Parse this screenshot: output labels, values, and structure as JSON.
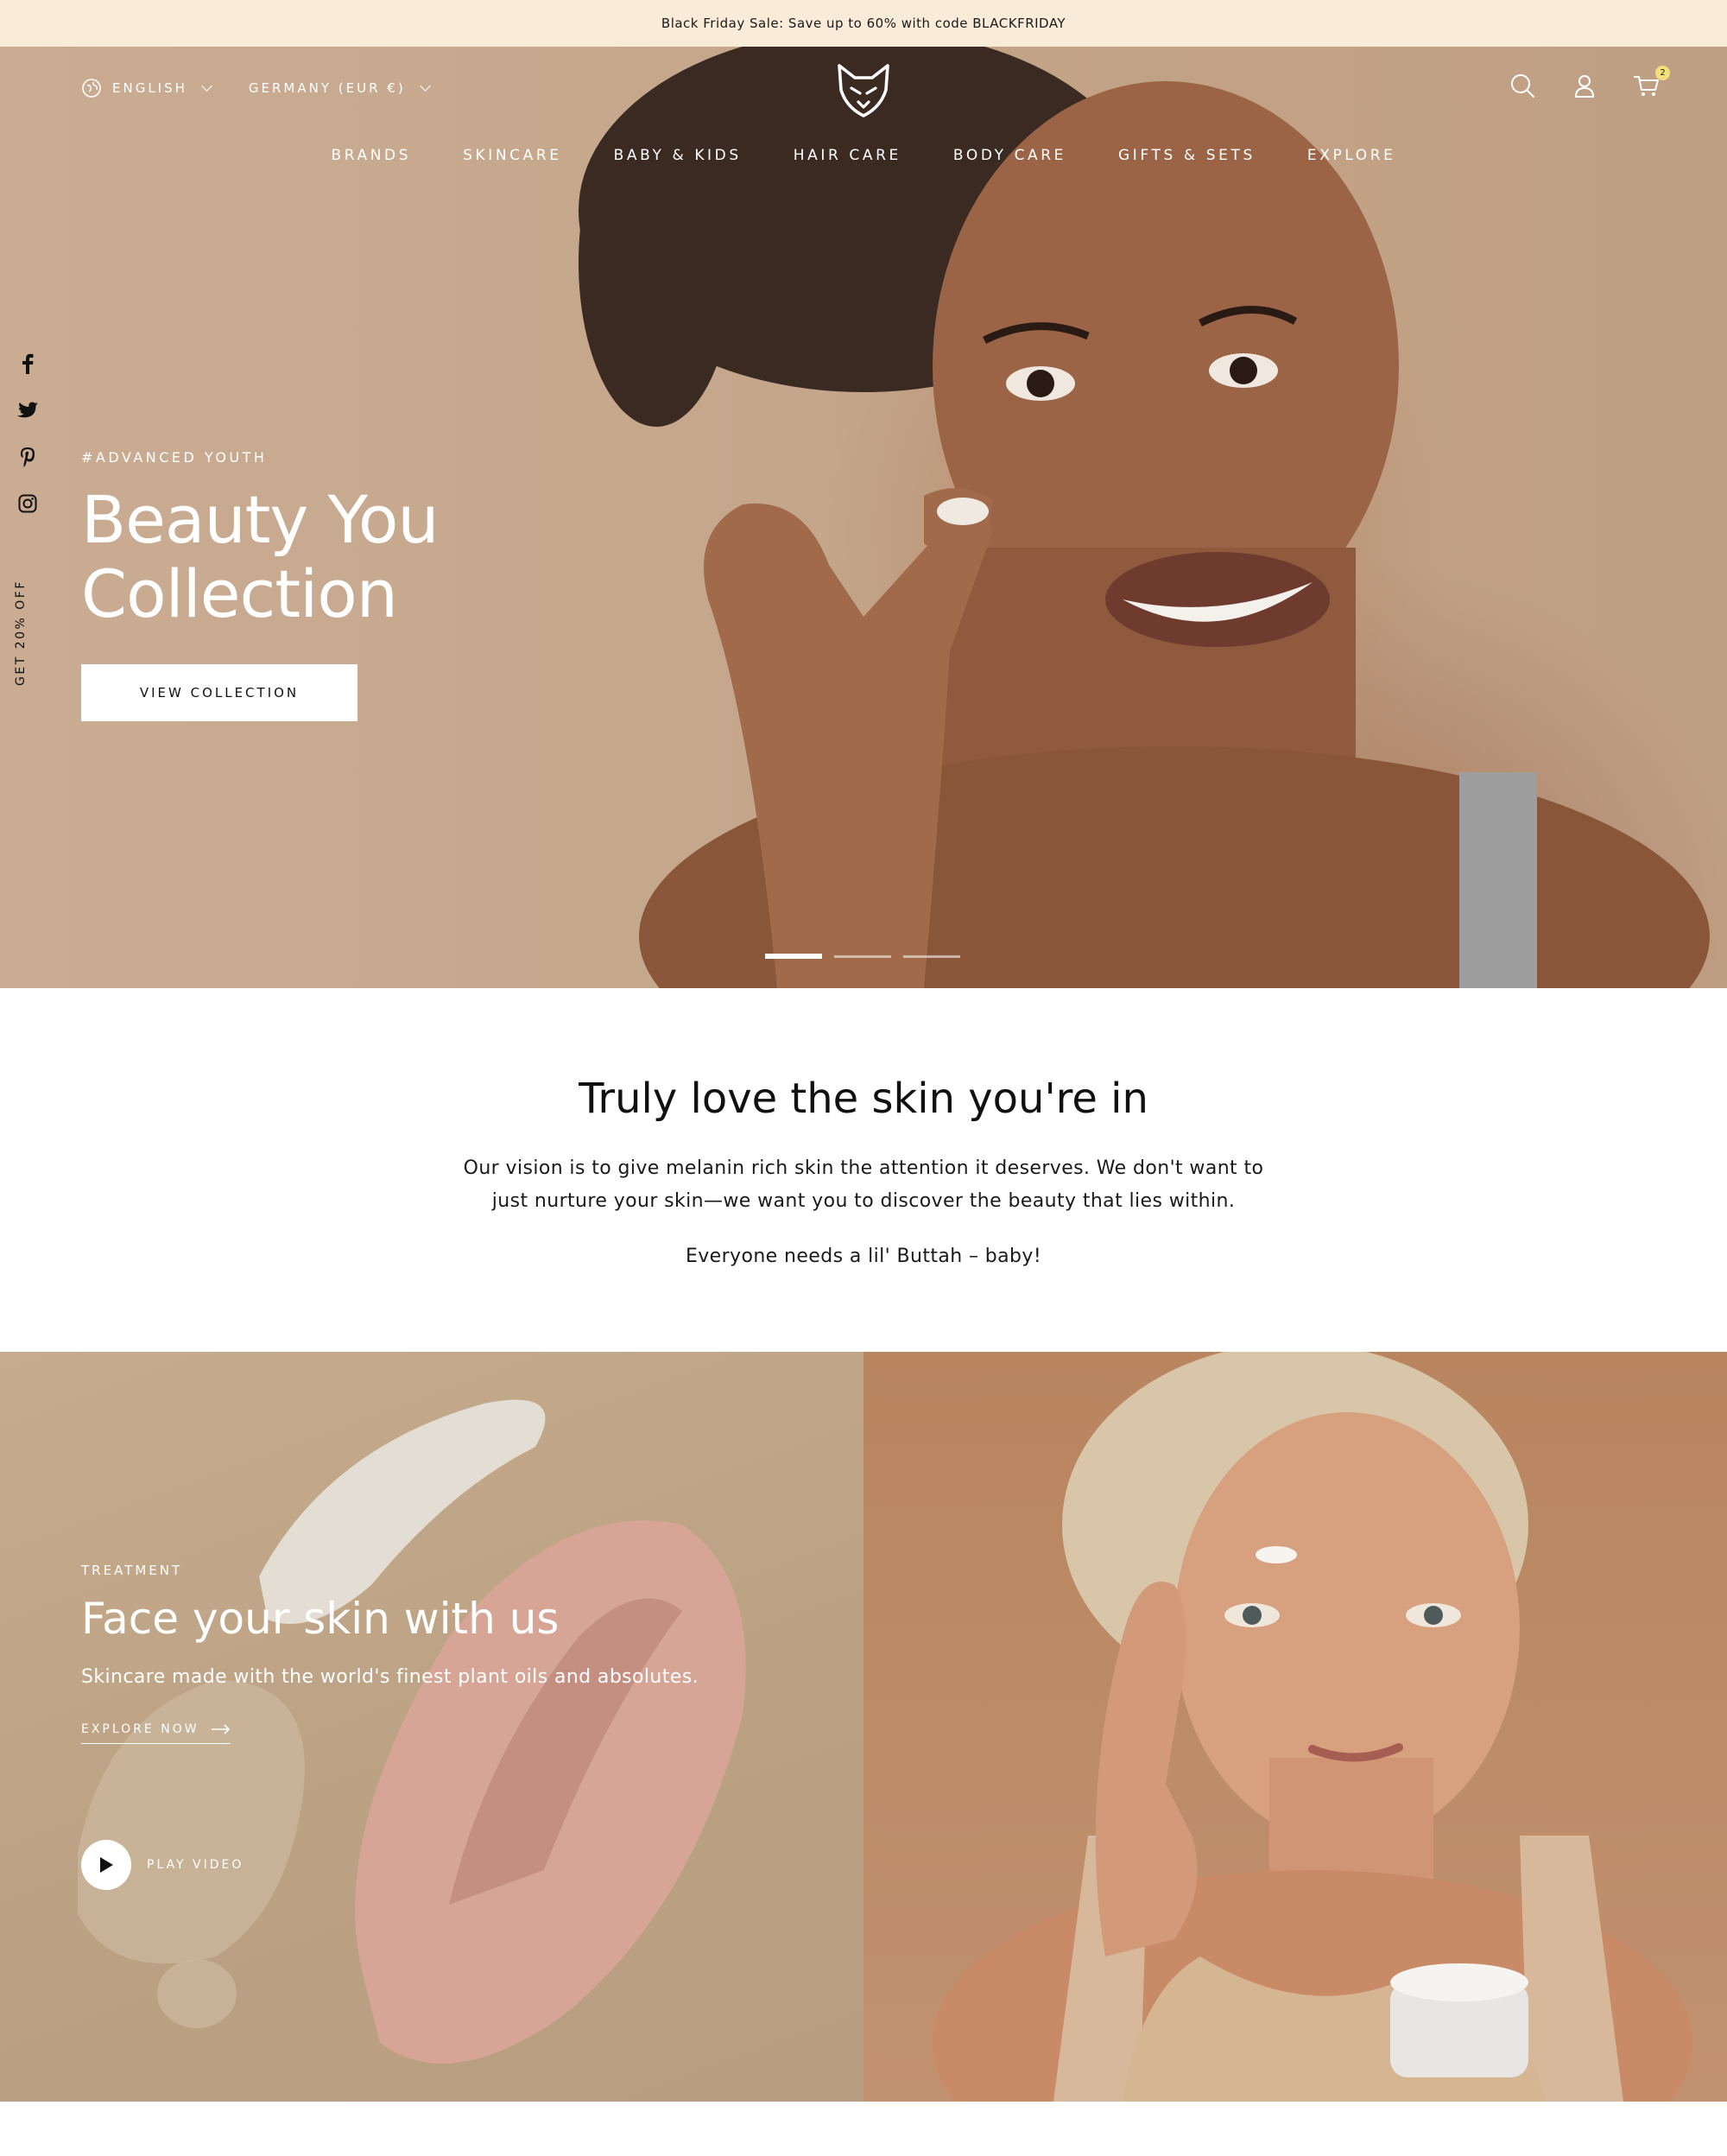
{
  "announcement": "Black Friday Sale: Save up to 60% with code BLACKFRIDAY",
  "header": {
    "language": "ENGLISH",
    "region": "GERMANY (EUR €)",
    "cart_count": "2"
  },
  "nav": [
    "BRANDS",
    "SKINCARE",
    "BABY & KIDS",
    "HAIR CARE",
    "BODY CARE",
    "GIFTS & SETS",
    "EXPLORE"
  ],
  "side_promo": "GET 20% OFF",
  "hero": {
    "tag": "#ADVANCED YOUTH",
    "title": "Beauty You Collection",
    "button": "VIEW COLLECTION",
    "slides_total": 3,
    "active_slide": 1
  },
  "intro": {
    "heading": "Truly love the skin you're in",
    "paragraph": "Our vision is to give melanin rich skin the attention it deserves. We don't want to just nurture your skin—we want you to discover the beauty that lies within.",
    "tagline": "Everyone needs a lil' Buttah – baby!"
  },
  "treatment": {
    "tag": "TREATMENT",
    "title": "Face your skin with us",
    "subtitle": "Skincare made with the world's finest plant oils and absolutes.",
    "link": "EXPLORE NOW",
    "video": "PLAY VIDEO"
  },
  "colors": {
    "announcement_bg": "#f8ecd9",
    "hero_bg": "#c5a78c",
    "cart_badge": "#f3e07a"
  }
}
